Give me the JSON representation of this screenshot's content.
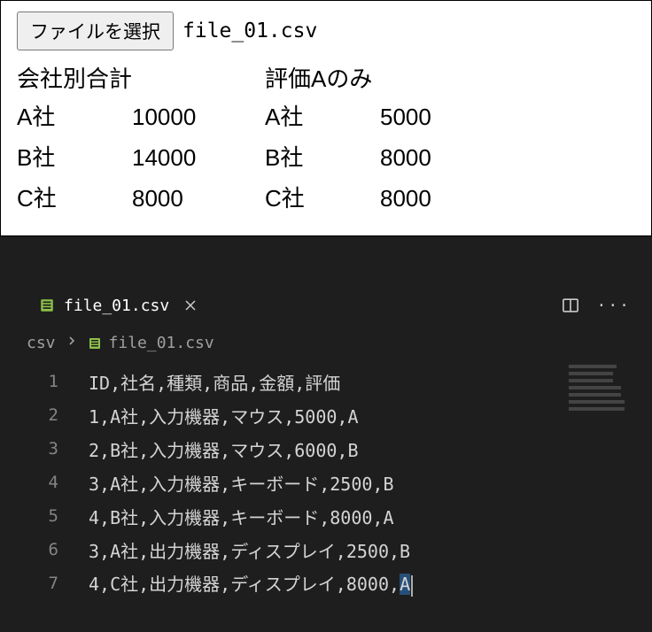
{
  "file_picker": {
    "button_label": "ファイルを選択",
    "selected_file": "file_01.csv"
  },
  "table1": {
    "title": "会社別合計",
    "rows": [
      {
        "company": "A社",
        "value": "10000"
      },
      {
        "company": "B社",
        "value": "14000"
      },
      {
        "company": "C社",
        "value": "8000"
      }
    ]
  },
  "table2": {
    "title": "評価Aのみ",
    "rows": [
      {
        "company": "A社",
        "value": "5000"
      },
      {
        "company": "B社",
        "value": "8000"
      },
      {
        "company": "C社",
        "value": "8000"
      }
    ]
  },
  "editor": {
    "tab": {
      "filename": "file_01.csv"
    },
    "breadcrumb": {
      "folder": "csv",
      "file": "file_01.csv"
    },
    "lines": [
      "ID,社名,種類,商品,金額,評価",
      "1,A社,入力機器,マウス,5000,A",
      "2,B社,入力機器,マウス,6000,B",
      "3,A社,入力機器,キーボード,2500,B",
      "4,B社,入力機器,キーボード,8000,A",
      "3,A社,出力機器,ディスプレイ,2500,B",
      "4,C社,出力機器,ディスプレイ,8000,A"
    ]
  }
}
